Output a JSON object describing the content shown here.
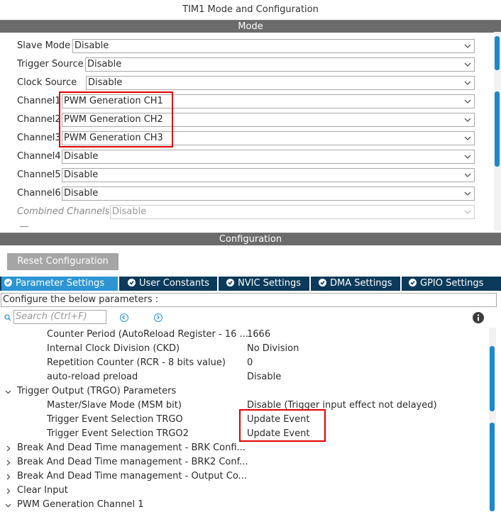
{
  "window_title": "TIM1 Mode and Configuration",
  "mode_bar": "Mode",
  "mode_fields": [
    {
      "label": "Slave Mode",
      "value": "Disable"
    },
    {
      "label": "Trigger Source",
      "value": "Disable"
    },
    {
      "label": "Clock Source",
      "value": "Disable"
    },
    {
      "label": "Channel1",
      "value": "PWM Generation CH1"
    },
    {
      "label": "Channel2",
      "value": "PWM Generation CH2"
    },
    {
      "label": "Channel3",
      "value": "PWM Generation CH3"
    },
    {
      "label": "Channel4",
      "value": "Disable"
    },
    {
      "label": "Channel5",
      "value": "Disable"
    },
    {
      "label": "Channel6",
      "value": "Disable"
    },
    {
      "label": "Combined Channels",
      "value": "Disable"
    }
  ],
  "config_bar": "Configuration",
  "reset_button": "Reset Configuration",
  "tabs": [
    "Parameter Settings",
    "User Constants",
    "NVIC Settings",
    "DMA Settings",
    "GPIO Settings"
  ],
  "configure_message": "Configure the below parameters :",
  "search_placeholder": "Search (Ctrl+F)",
  "params": [
    {
      "name": "Counter Period (AutoReload Register - 16 ...",
      "value": "1666"
    },
    {
      "name": "Internal Clock Division (CKD)",
      "value": "No Division"
    },
    {
      "name": "Repetition Counter (RCR - 8 bits value)",
      "value": "0"
    },
    {
      "name": "auto-reload preload",
      "value": "Disable"
    },
    {
      "group": "Trigger Output (TRGO) Parameters"
    },
    {
      "name": "Master/Slave Mode (MSM bit)",
      "value": "Disable (Trigger input effect not delayed)"
    },
    {
      "name": "Trigger Event Selection TRGO",
      "value": "Update Event"
    },
    {
      "name": "Trigger Event Selection TRGO2",
      "value": "Update Event"
    },
    {
      "group": "Break And Dead Time management - BRK Confi..."
    },
    {
      "group": "Break And Dead Time management - BRK2 Conf..."
    },
    {
      "group": "Break And Dead Time management - Output Co..."
    },
    {
      "group": "Clear Input"
    },
    {
      "group": "PWM Generation Channel 1"
    }
  ],
  "colors": {
    "accent": "#2d95d3",
    "tab_bar": "#0b3a5a",
    "highlight": "#e00000",
    "section_bar": "#6b6b6b"
  }
}
